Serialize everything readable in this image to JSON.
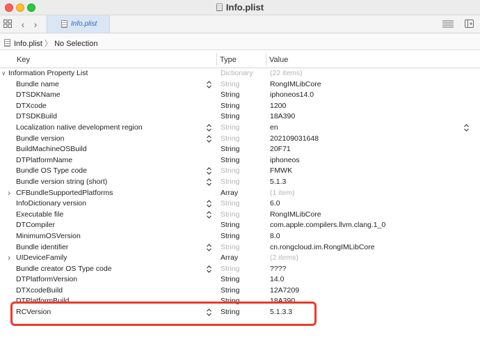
{
  "window": {
    "title": "Info.plist"
  },
  "tabbar": {
    "active_tab": "Info.plist"
  },
  "jumpbar": {
    "file": "Info.plist",
    "separator": "〉",
    "selection": "No Selection"
  },
  "columns": {
    "key": "Key",
    "type": "Type",
    "value": "Value"
  },
  "root": {
    "key": "Information Property List",
    "type": "Dictionary",
    "value": "(22 items)"
  },
  "rows": [
    {
      "key": "Bundle name",
      "type": "String",
      "value": "RongIMLibCore",
      "dim": true,
      "stepper": true
    },
    {
      "key": "DTSDKName",
      "type": "String",
      "value": "iphoneos14.0"
    },
    {
      "key": "DTXcode",
      "type": "String",
      "value": "1200"
    },
    {
      "key": "DTSDKBuild",
      "type": "String",
      "value": "18A390"
    },
    {
      "key": "Localization native development region",
      "type": "String",
      "value": "en",
      "dim": true,
      "stepper": true,
      "valueStepper": true
    },
    {
      "key": "Bundle version",
      "type": "String",
      "value": "202109031648",
      "dim": true,
      "stepper": true
    },
    {
      "key": "BuildMachineOSBuild",
      "type": "String",
      "value": "20F71"
    },
    {
      "key": "DTPlatformName",
      "type": "String",
      "value": "iphoneos"
    },
    {
      "key": "Bundle OS Type code",
      "type": "String",
      "value": "FMWK",
      "dim": true,
      "stepper": true
    },
    {
      "key": "Bundle version string (short)",
      "type": "String",
      "value": "5.1.3",
      "dim": true,
      "stepper": true
    },
    {
      "key": "CFBundleSupportedPlatforms",
      "type": "Array",
      "value": "(1 item)",
      "disclosure": true,
      "dimValue": true
    },
    {
      "key": "InfoDictionary version",
      "type": "String",
      "value": "6.0",
      "dim": true,
      "stepper": true
    },
    {
      "key": "Executable file",
      "type": "String",
      "value": "RongIMLibCore",
      "dim": true,
      "stepper": true
    },
    {
      "key": "DTCompiler",
      "type": "String",
      "value": "com.apple.compilers.llvm.clang.1_0"
    },
    {
      "key": "MinimumOSVersion",
      "type": "String",
      "value": "8.0"
    },
    {
      "key": "Bundle identifier",
      "type": "String",
      "value": "cn.rongcloud.im.RongIMLibCore",
      "dim": true,
      "stepper": true
    },
    {
      "key": "UIDeviceFamily",
      "type": "Array",
      "value": "(2 items)",
      "disclosure": true,
      "dimValue": true
    },
    {
      "key": "Bundle creator OS Type code",
      "type": "String",
      "value": "????",
      "dim": true,
      "stepper": true
    },
    {
      "key": "DTPlatformVersion",
      "type": "String",
      "value": "14.0"
    },
    {
      "key": "DTXcodeBuild",
      "type": "String",
      "value": "12A7209"
    },
    {
      "key": "DTPlatformBuild",
      "type": "String",
      "value": "18A390"
    },
    {
      "key": "RCVersion",
      "type": "String",
      "value": "5.1.3.3",
      "stepper": true
    }
  ],
  "highlight_color": "#ec3a2c"
}
